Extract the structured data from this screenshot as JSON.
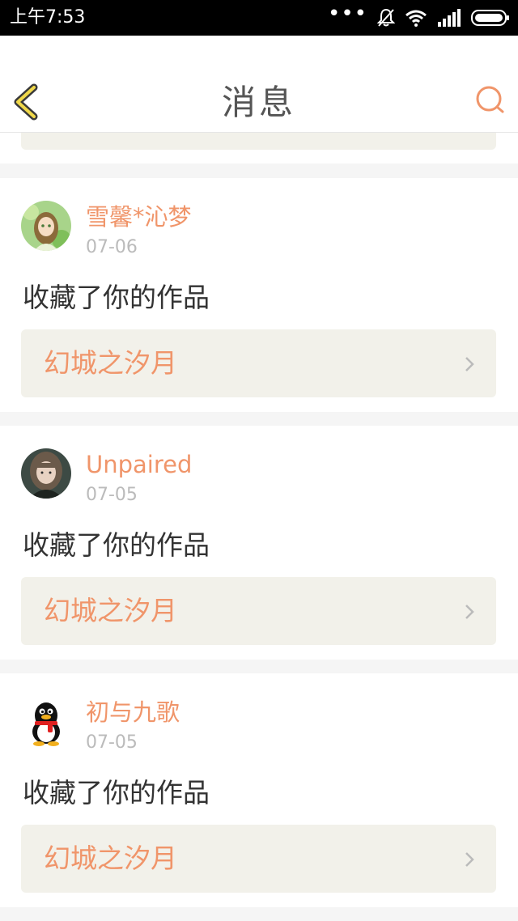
{
  "status_bar": {
    "time": "上午7:53"
  },
  "header": {
    "title": "消息",
    "accent_color": "#f0956a"
  },
  "messages": [
    {
      "username": "雪馨*沁梦",
      "date": "07-06",
      "action": "收藏了你的作品",
      "work_title": "幻城之汐月"
    },
    {
      "username": "Unpaired",
      "date": "07-05",
      "action": "收藏了你的作品",
      "work_title": "幻城之汐月"
    },
    {
      "username": "初与九歌",
      "date": "07-05",
      "action": "收藏了你的作品",
      "work_title": "幻城之汐月"
    }
  ]
}
